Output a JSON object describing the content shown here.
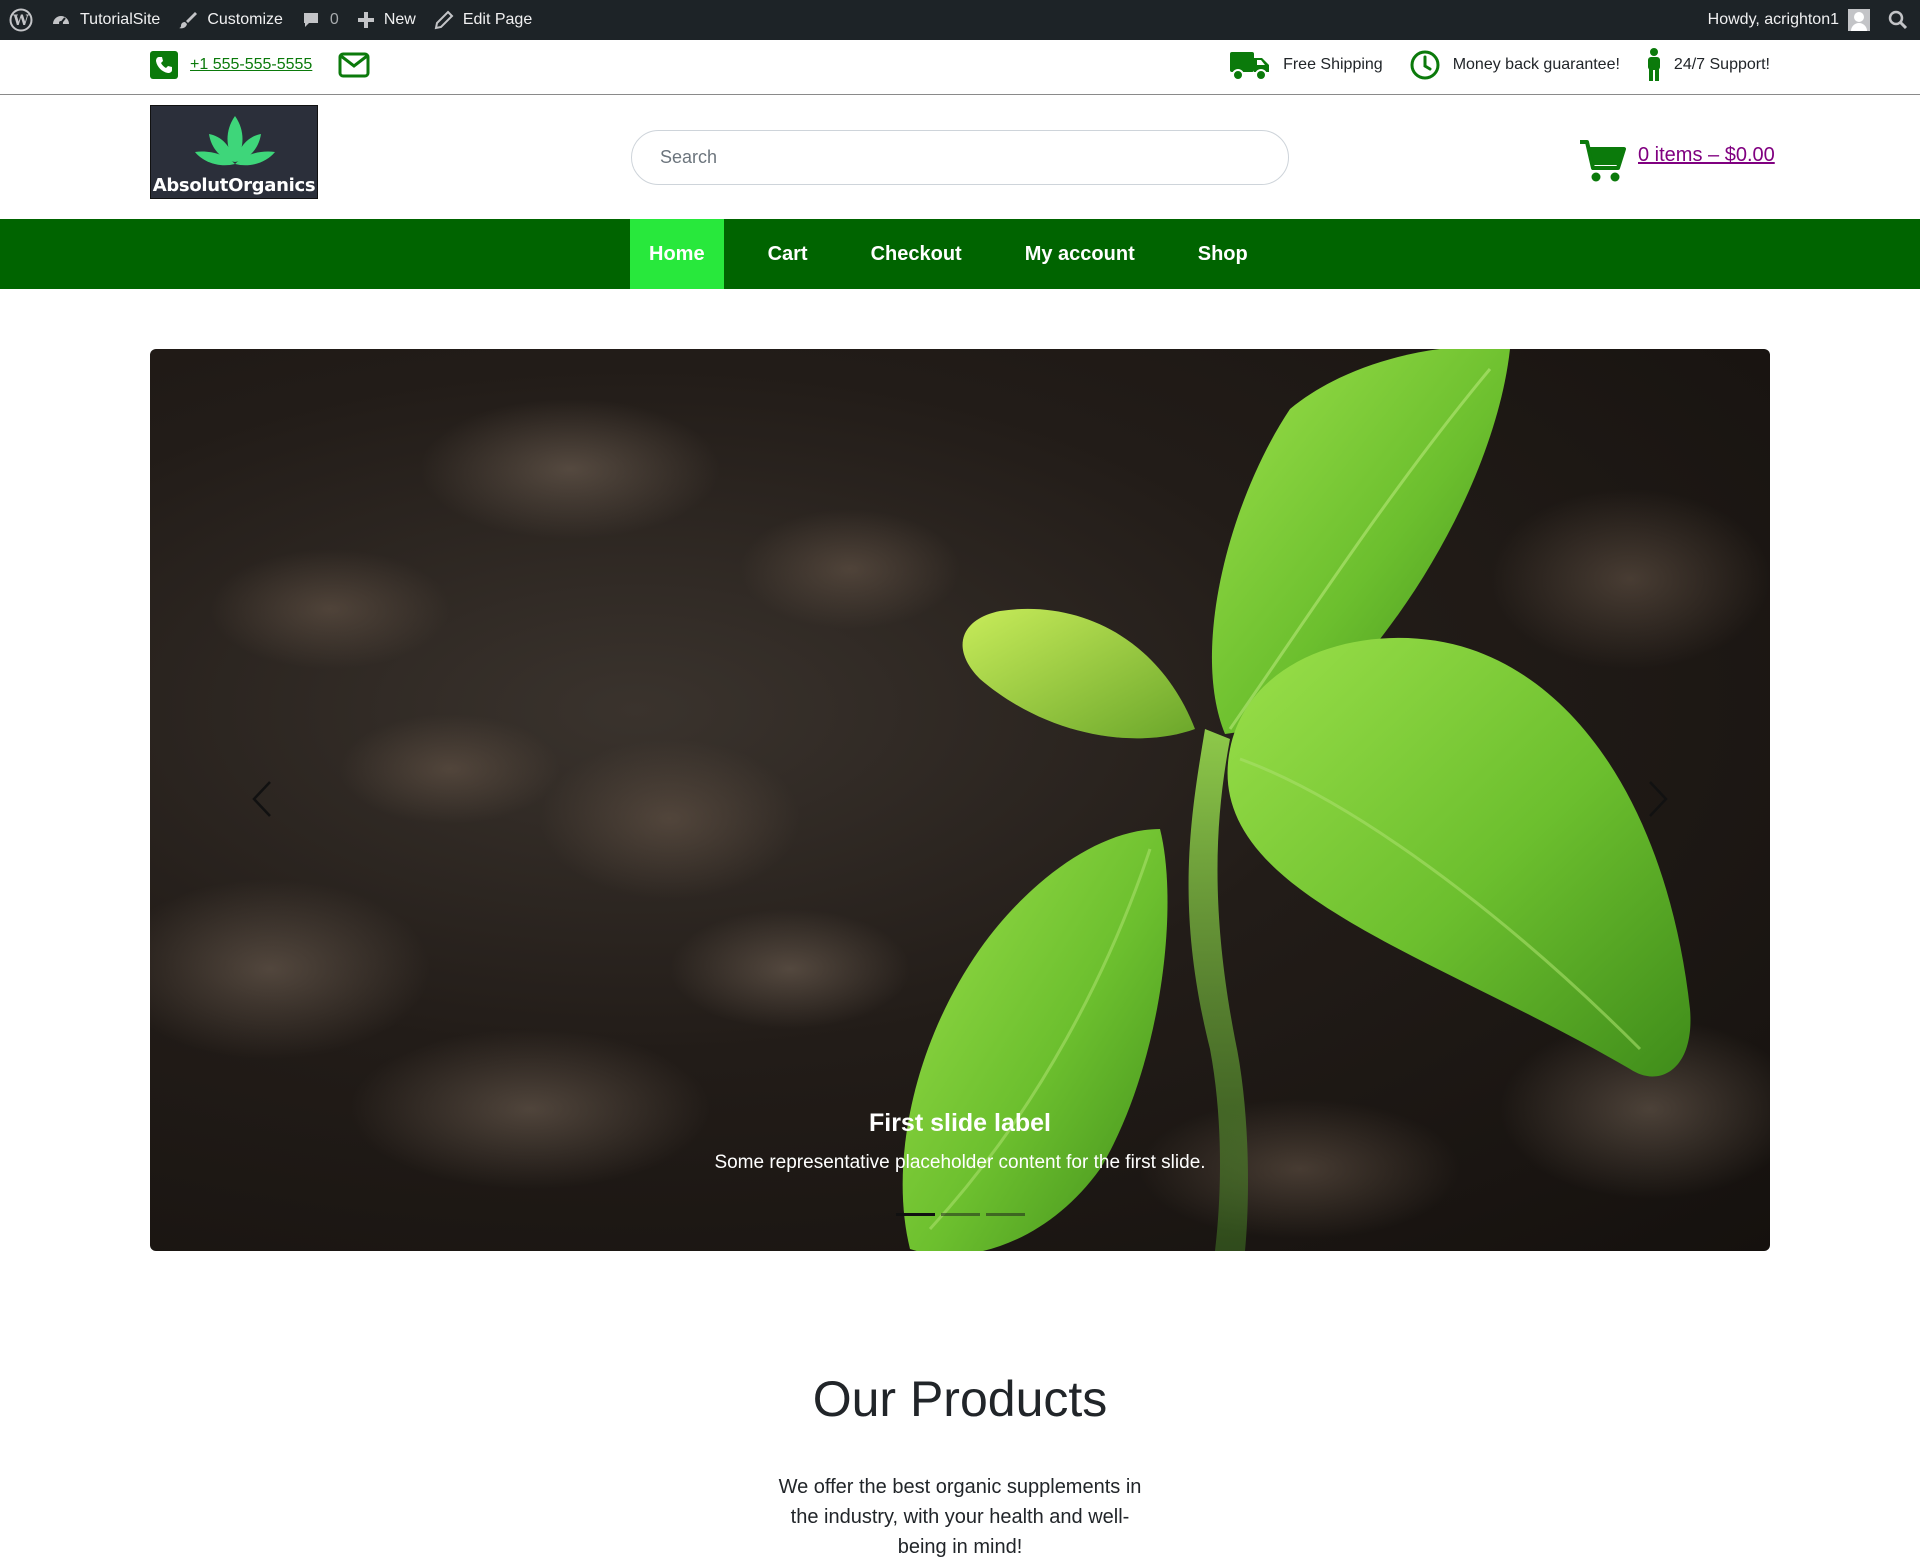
{
  "adminbar": {
    "site_name": "TutorialSite",
    "customize": "Customize",
    "comments_count": "0",
    "new": "New",
    "edit_page": "Edit Page",
    "howdy": "Howdy, acrighton1"
  },
  "infobar": {
    "phone": "+1 555-555-5555",
    "features": [
      "Free Shipping",
      "Money back guarantee!",
      "24/7 Support!"
    ]
  },
  "header": {
    "logo_text": "AbsolutOrganics",
    "search_placeholder": "Search",
    "cart_text": "0 items – $0.00"
  },
  "nav": {
    "items": [
      "Home",
      "Cart",
      "Checkout",
      "My account",
      "Shop"
    ],
    "active": "Home"
  },
  "carousel": {
    "slide_title": "First slide label",
    "slide_text": "Some representative placeholder content for the first slide.",
    "slide_count": 3,
    "active_slide": 1
  },
  "products": {
    "title": "Our Products",
    "description": "We offer the best organic supplements in the industry, with your health and well-being in mind!"
  },
  "colors": {
    "adminbar_bg": "#1d2327",
    "brand_green": "#006400",
    "active_nav": "#28e83c",
    "icon_green": "#0b7a0b",
    "cart_link": "#800080"
  }
}
